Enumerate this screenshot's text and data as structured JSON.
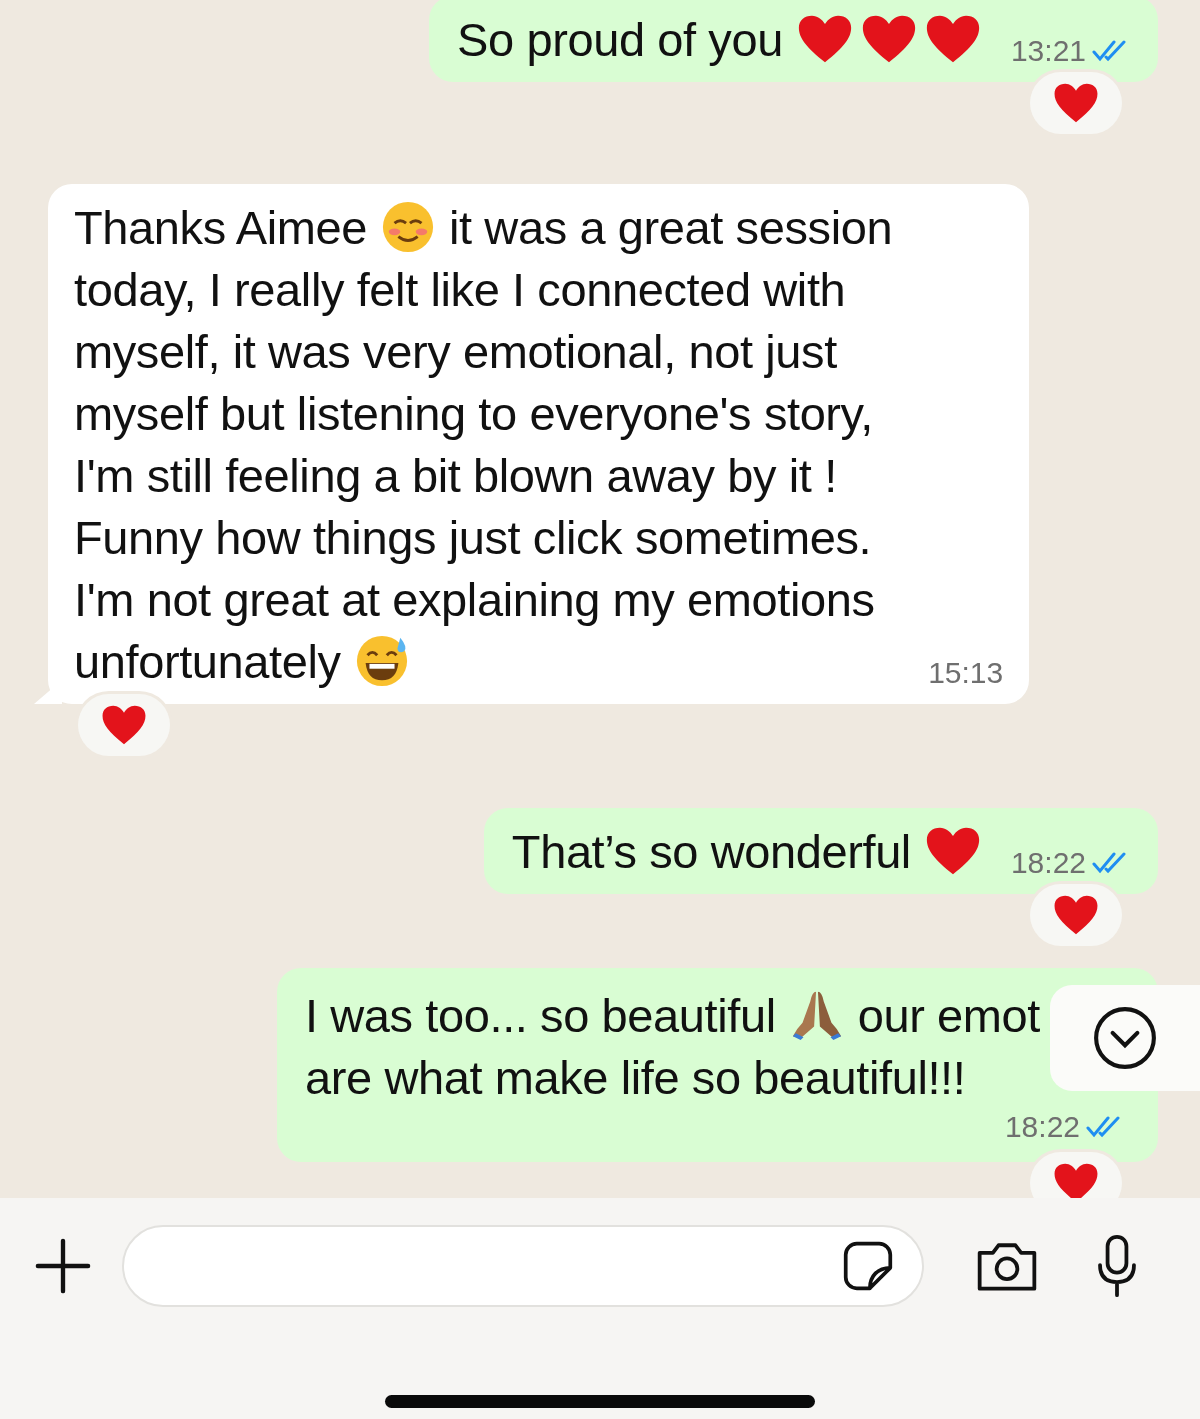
{
  "messages": [
    {
      "outgoing": true,
      "lines": [
        [
          {
            "kind": "text",
            "text": "So proud of you"
          },
          {
            "kind": "heart"
          },
          {
            "kind": "heart"
          },
          {
            "kind": "heart"
          }
        ]
      ],
      "time": "13:21",
      "read": true,
      "reaction": {
        "kind": "heart"
      }
    },
    {
      "outgoing": false,
      "lines": [
        [
          {
            "kind": "text",
            "text": "Thanks Aimee"
          },
          {
            "kind": "smile"
          },
          {
            "kind": "text",
            "text": "it was a great session"
          }
        ],
        [
          {
            "kind": "text",
            "text": "today, I really felt like I connected with"
          }
        ],
        [
          {
            "kind": "text",
            "text": "myself, it was very emotional, not just"
          }
        ],
        [
          {
            "kind": "text",
            "text": "myself but listening to everyone's story,"
          }
        ],
        [
          {
            "kind": "text",
            "text": "I'm still feeling a bit blown away by it !"
          }
        ],
        [
          {
            "kind": "text",
            "text": "Funny how things just click sometimes."
          }
        ],
        [
          {
            "kind": "text",
            "text": "I'm not great at explaining my emotions"
          }
        ],
        [
          {
            "kind": "text",
            "text": "unfortunately"
          },
          {
            "kind": "sweat"
          }
        ]
      ],
      "time": "15:13",
      "reaction": {
        "kind": "heart"
      }
    },
    {
      "outgoing": true,
      "lines": [
        [
          {
            "kind": "text",
            "text": "That’s so wonderful"
          },
          {
            "kind": "heart"
          }
        ]
      ],
      "time": "18:22",
      "read": true,
      "reaction": {
        "kind": "heart"
      }
    },
    {
      "outgoing": true,
      "lines": [
        [
          {
            "kind": "text",
            "text": "I was too... so beautiful"
          },
          {
            "kind": "pray"
          },
          {
            "kind": "text",
            "text": "our emot"
          }
        ],
        [
          {
            "kind": "text",
            "text": "are what make life so beautiful!!!"
          }
        ]
      ],
      "time": "18:22",
      "read": true,
      "reaction": {
        "kind": "heart"
      }
    }
  ],
  "scroll_down_button": true
}
